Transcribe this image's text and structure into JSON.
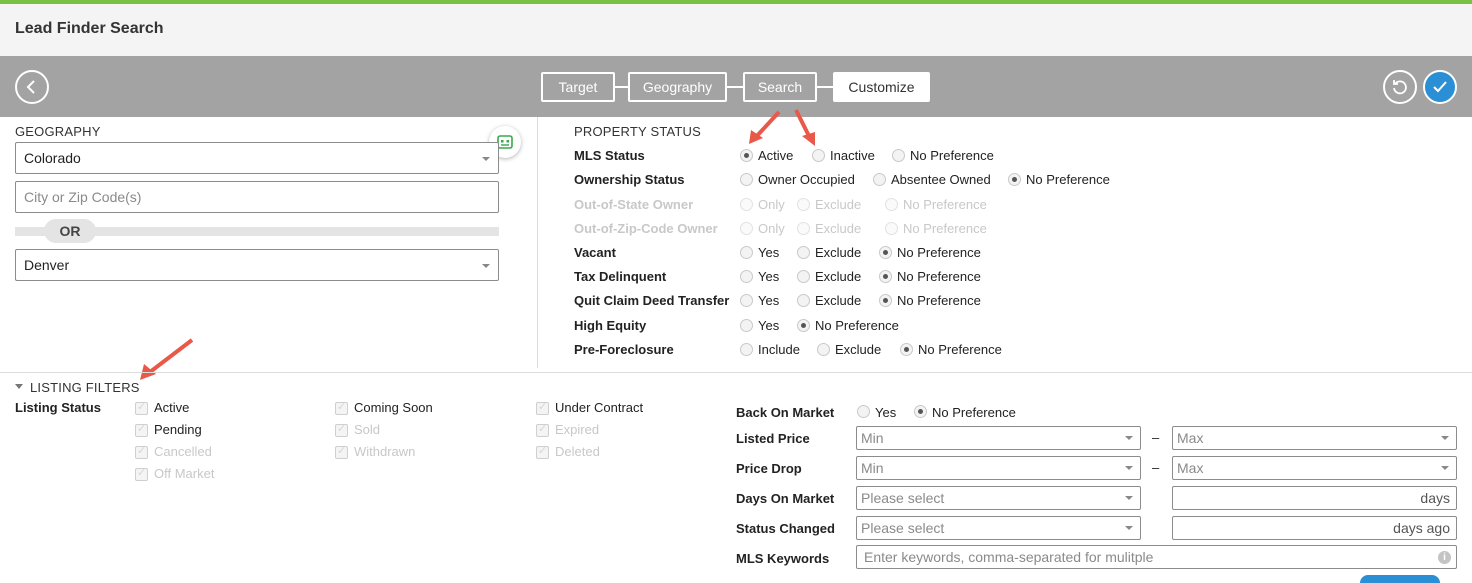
{
  "app_title": "Lead Finder Search",
  "steps": [
    "Target",
    "Geography",
    "Search",
    "Customize"
  ],
  "geography": {
    "heading": "GEOGRAPHY",
    "state": "Colorado",
    "city_placeholder": "City or Zip Code(s)",
    "or_label": "OR",
    "county": "Denver"
  },
  "property_status": {
    "heading": "PROPERTY STATUS",
    "rows": [
      {
        "label": "MLS Status",
        "options": [
          "Active",
          "Inactive",
          "No Preference"
        ]
      },
      {
        "label": "Ownership Status",
        "options": [
          "Owner Occupied",
          "Absentee Owned",
          "No Preference"
        ]
      },
      {
        "label": "Out-of-State Owner",
        "options": [
          "Only",
          "Exclude",
          "No Preference"
        ]
      },
      {
        "label": "Out-of-Zip-Code Owner",
        "options": [
          "Only",
          "Exclude",
          "No Preference"
        ]
      },
      {
        "label": "Vacant",
        "options": [
          "Yes",
          "Exclude",
          "No Preference"
        ]
      },
      {
        "label": "Tax Delinquent",
        "options": [
          "Yes",
          "Exclude",
          "No Preference"
        ]
      },
      {
        "label": "Quit Claim Deed Transfer",
        "options": [
          "Yes",
          "Exclude",
          "No Preference"
        ]
      },
      {
        "label": "High Equity",
        "options": [
          "Yes",
          "No Preference"
        ]
      },
      {
        "label": "Pre-Foreclosure",
        "options": [
          "Include",
          "Exclude",
          "No Preference"
        ]
      }
    ]
  },
  "listing_filters": {
    "heading": "LISTING FILTERS",
    "status_label": "Listing Status",
    "col1": [
      "Active",
      "Pending",
      "Cancelled",
      "Off Market"
    ],
    "col2": [
      "Coming Soon",
      "Sold",
      "Withdrawn"
    ],
    "col3": [
      "Under Contract",
      "Expired",
      "Deleted"
    ],
    "back_on_market": {
      "label": "Back On Market",
      "options": [
        "Yes",
        "No Preference"
      ]
    },
    "listed_price": {
      "label": "Listed Price",
      "min": "Min",
      "max": "Max",
      "dash": "–"
    },
    "price_drop": {
      "label": "Price Drop",
      "min": "Min",
      "max": "Max",
      "dash": "–"
    },
    "days_on_market": {
      "label": "Days On Market",
      "select": "Please select",
      "unit": "days"
    },
    "status_changed": {
      "label": "Status Changed",
      "select": "Please select",
      "unit": "days ago"
    },
    "mls_keywords": {
      "label": "MLS Keywords",
      "placeholder": "Enter keywords, comma-separated for mulitple"
    }
  },
  "colors": {
    "accent_green": "#7ac143",
    "check_blue": "#2b8fd6",
    "annotation_red": "#e8594a",
    "bar_gray": "#a3a3a3"
  },
  "icons": [
    "back-arrow-icon",
    "reset-icon",
    "confirm-check-icon",
    "map-chat-icon",
    "info-icon",
    "chevron-down-icon"
  ]
}
